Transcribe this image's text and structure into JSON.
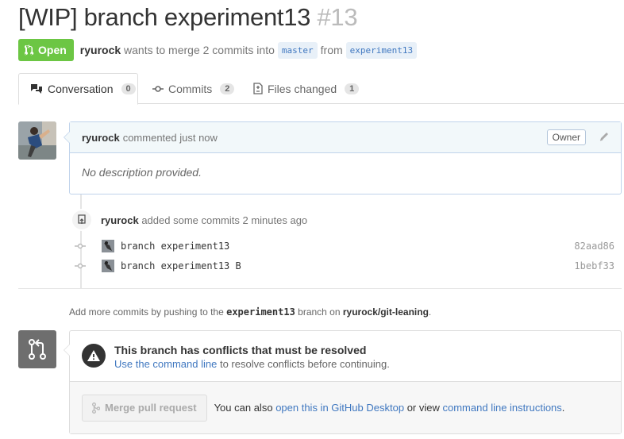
{
  "pr": {
    "title": "[WIP] branch experiment13",
    "number": "#13",
    "state": "Open",
    "author": "ryurock",
    "merge_text": "wants to merge 2 commits into",
    "base_branch": "master",
    "from_text": "from",
    "head_branch": "experiment13"
  },
  "tabs": [
    {
      "label": "Conversation",
      "count": "0",
      "icon": "comment-discussion-icon"
    },
    {
      "label": "Commits",
      "count": "2",
      "icon": "git-commit-icon"
    },
    {
      "label": "Files changed",
      "count": "1",
      "icon": "file-diff-icon"
    }
  ],
  "comment": {
    "author": "ryurock",
    "action": "commented just now",
    "badge": "Owner",
    "body": "No description provided."
  },
  "event": {
    "author": "ryurock",
    "text": "added some commits 2 minutes ago"
  },
  "commits": [
    {
      "message": "branch experiment13",
      "sha": "82aad86"
    },
    {
      "message": "branch experiment13 B",
      "sha": "1bebf33"
    }
  ],
  "push_hint": {
    "prefix": "Add more commits by pushing to the",
    "branch": "experiment13",
    "middle": "branch on",
    "repo": "ryurock/git-leaning",
    "suffix": "."
  },
  "merge": {
    "conflict_title": "This branch has conflicts that must be resolved",
    "conflict_link": "Use the command line",
    "conflict_rest": "to resolve conflicts before continuing.",
    "button_label": "Merge pull request",
    "alt_prefix": "You can also",
    "alt_link1": "open this in GitHub Desktop",
    "alt_middle": "or view",
    "alt_link2": "command line instructions",
    "alt_suffix": "."
  },
  "colors": {
    "open_green": "#6cc644",
    "link_blue": "#4078c0",
    "comment_border": "#c0d3eb"
  }
}
